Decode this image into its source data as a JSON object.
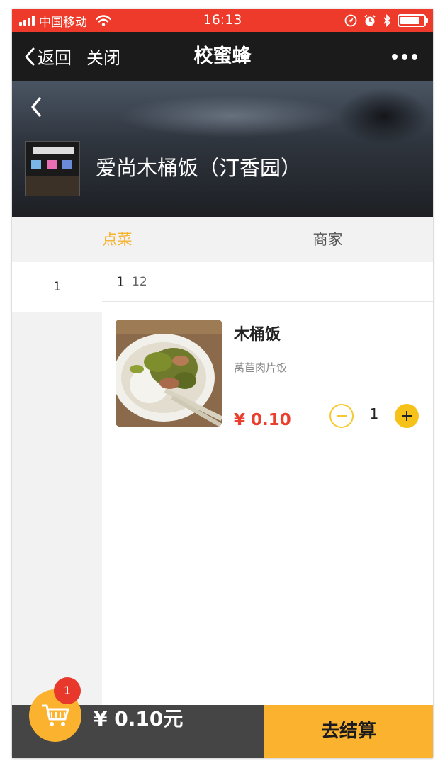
{
  "status_bar": {
    "carrier": "中国移动",
    "time": "16:13",
    "battery_level": 0.8
  },
  "nav": {
    "back_label": "返回",
    "close_label": "关闭",
    "title": "校蜜蜂"
  },
  "shop": {
    "name": "爱尚木桶饭（汀香园）"
  },
  "tabs": [
    {
      "label": "点菜",
      "active": true
    },
    {
      "label": "商家",
      "active": false
    }
  ],
  "category_sidebar": [
    {
      "label": "1",
      "selected": true
    }
  ],
  "category": {
    "number": "1",
    "count": "12"
  },
  "items": [
    {
      "name": "木桶饭",
      "description": "莴苣肉片饭",
      "price": "¥ 0.10",
      "quantity": "1"
    }
  ],
  "cart": {
    "badge_count": "1",
    "total": "¥ 0.10元",
    "checkout_label": "去结算"
  },
  "colors": {
    "status_bar": "#ee3a2a",
    "nav_bar": "#1b1b1b",
    "accent": "#f6b433",
    "price": "#ea3f2c",
    "checkout": "#fbb22f",
    "bottom_bar": "#454545"
  },
  "icons": [
    "signal-icon",
    "wifi-icon",
    "location-icon",
    "alarm-icon",
    "bluetooth-icon",
    "battery-icon",
    "back-chevron-icon",
    "more-icon",
    "minus-icon",
    "plus-icon",
    "cart-icon"
  ]
}
